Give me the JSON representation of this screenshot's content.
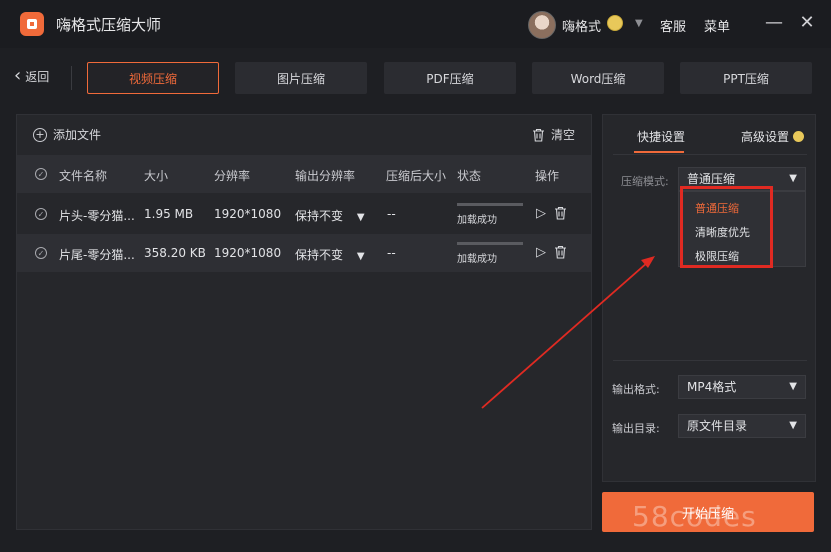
{
  "app": {
    "title": "嗨格式压缩大师"
  },
  "user": {
    "name": "嗨格式"
  },
  "top_links": {
    "service": "客服",
    "menu": "菜单"
  },
  "window_controls": {
    "minimize": "—",
    "close": "✕"
  },
  "nav": {
    "back_label": "返回",
    "tabs": [
      {
        "label": "视频压缩",
        "active": true
      },
      {
        "label": "图片压缩"
      },
      {
        "label": "PDF压缩"
      },
      {
        "label": "Word压缩"
      },
      {
        "label": "PPT压缩"
      }
    ]
  },
  "toolbar": {
    "add_file": "添加文件",
    "clear": "清空"
  },
  "table": {
    "columns": [
      "文件名称",
      "大小",
      "分辨率",
      "输出分辨率",
      "压缩后大小",
      "状态",
      "操作"
    ],
    "rows": [
      {
        "name": "片头-零分猫...",
        "size": "1.95 MB",
        "resolution": "1920*1080",
        "output_resolution": "保持不变",
        "compressed_size": "--",
        "status": "加载成功",
        "progress": 1.0
      },
      {
        "name": "片尾-零分猫...",
        "size": "358.20 KB",
        "resolution": "1920*1080",
        "output_resolution": "保持不变",
        "compressed_size": "--",
        "status": "加载成功",
        "progress": 1.0
      }
    ]
  },
  "settings": {
    "tabs": {
      "quick": "快捷设置",
      "advanced": "高级设置"
    },
    "mode_label": "压缩模式:",
    "mode_value": "普通压缩",
    "mode_options": [
      "普通压缩",
      "清晰度优先",
      "极限压缩"
    ],
    "output_format_label": "输出格式:",
    "output_format_value": "MP4格式",
    "output_dir_label": "输出目录:",
    "output_dir_value": "原文件目录"
  },
  "start_button": "开始压缩",
  "watermark": "58codes",
  "colors": {
    "accent": "#f06a3a",
    "highlight": "#e02a22",
    "background": "#1e1f23"
  }
}
